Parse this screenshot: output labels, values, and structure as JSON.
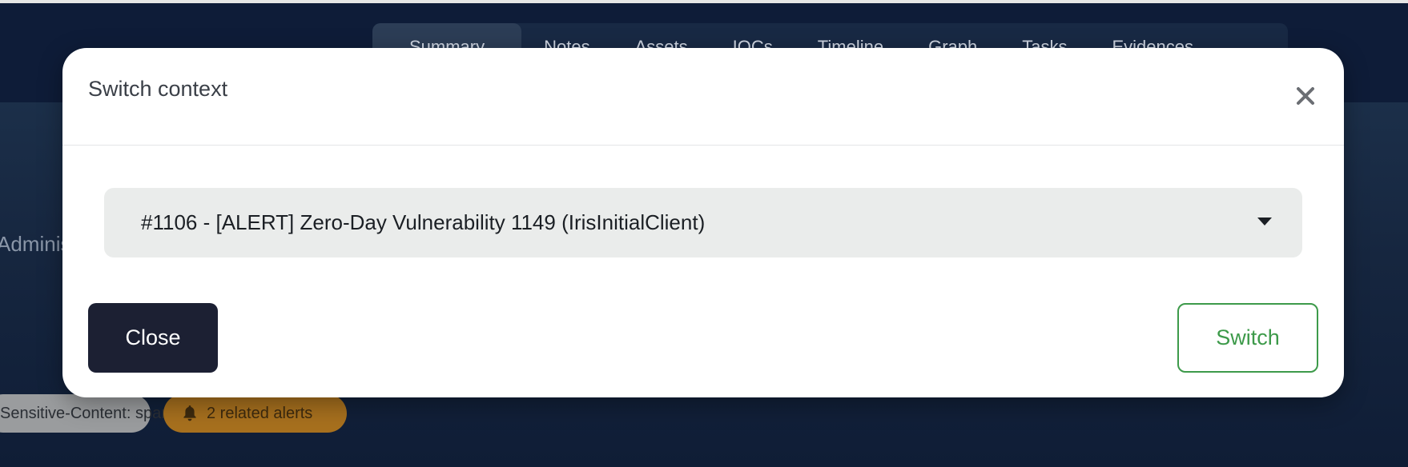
{
  "background": {
    "tabs": [
      "Summary",
      "Notes",
      "Assets",
      "IOCs",
      "Timeline",
      "Graph",
      "Tasks",
      "Evidences"
    ],
    "admin_text": "Administrator",
    "pills": {
      "content_tag": "Sensitive-Content: spam",
      "related_alerts": "2 related alerts"
    }
  },
  "modal": {
    "title": "Switch context",
    "close_icon": "close-icon",
    "select": {
      "value": "#1106 - [ALERT] Zero-Day Vulnerability 1149 (IrisInitialClient)"
    },
    "close_label": "Close",
    "switch_label": "Switch"
  },
  "colors": {
    "switch_green": "#3d9a4a",
    "close_button_bg": "#1c2033",
    "alerts_pill": "#a7701e"
  }
}
